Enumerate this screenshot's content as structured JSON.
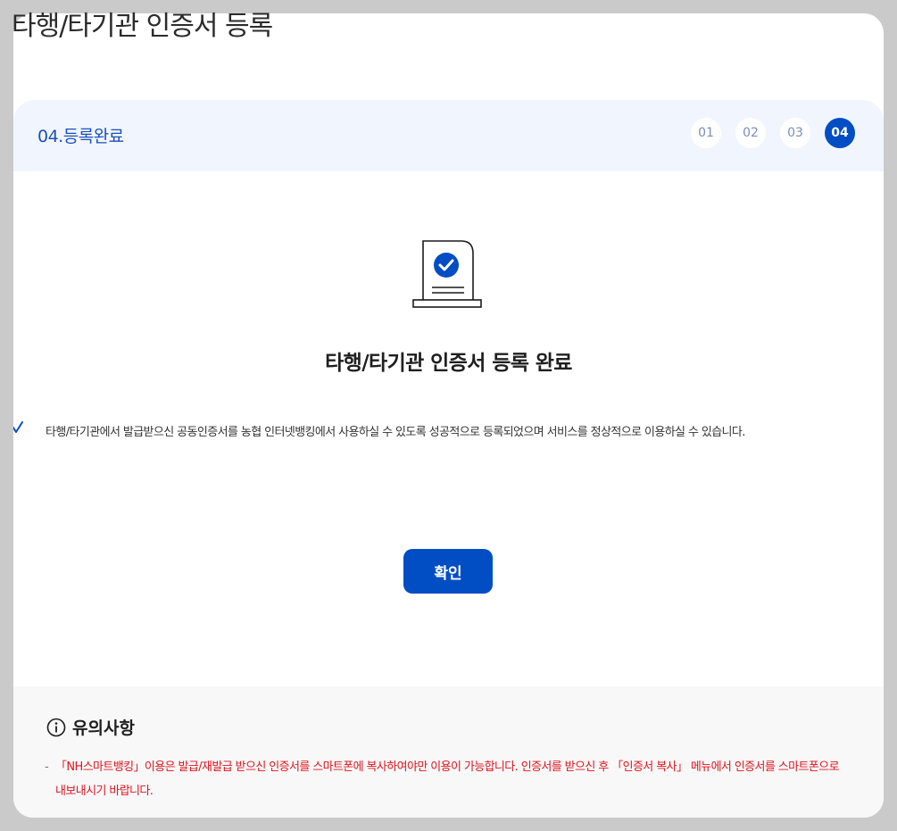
{
  "page": {
    "title": "타행/타기관 인증서 등록"
  },
  "steps": {
    "current_label": "04.등록완료",
    "items": [
      "01",
      "02",
      "03",
      "04"
    ],
    "active": "04"
  },
  "result": {
    "icon": "certificate-check-icon",
    "title": "타행/타기관 인증서 등록 완료",
    "message": "타행/타기관에서 발급받으신 공동인증서를 농협 인터넷뱅킹에서 사용하실 수 있도록 성공적으로 등록되었으며 서비스를 정상적으로 이용하실 수 있습니다."
  },
  "actions": {
    "confirm_label": "확인"
  },
  "notice": {
    "title": "유의사항",
    "bullet": "-",
    "item": "「NH스마트뱅킹」이용은 발급/재발급 받으신 인증서를 스마트폰에 복사하여야만 이용이 가능합니다. 인증서를 받으신 후 「인증서 복사」 메뉴에서 인증서를 스마트폰으로 내보내시기 바랍니다."
  },
  "colors": {
    "accent": "#004dc4",
    "step_bar_bg": "#f1f6fe",
    "notice_text": "#e0141e",
    "backdrop": "#cacaca"
  }
}
